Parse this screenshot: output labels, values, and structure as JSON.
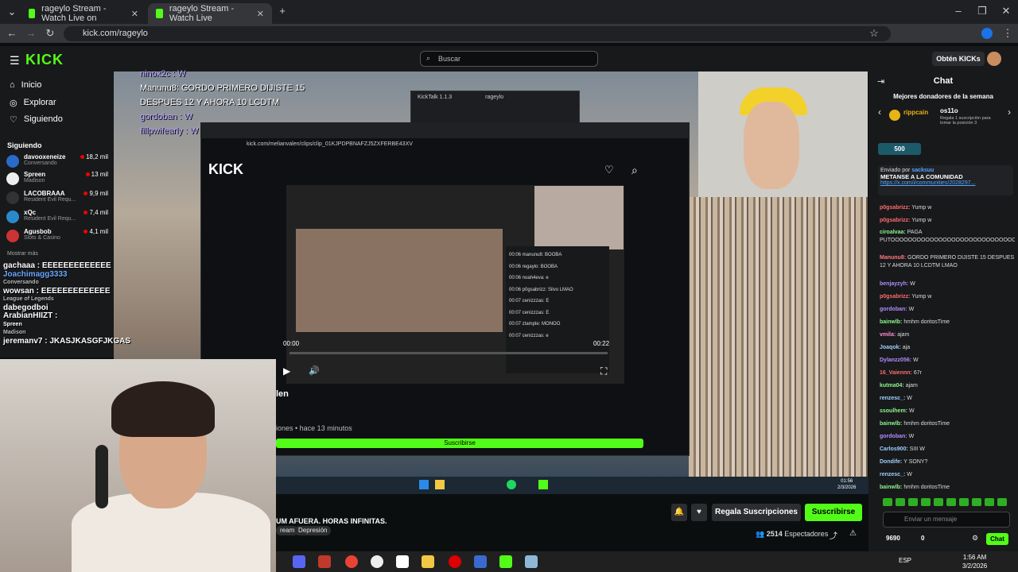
{
  "browser": {
    "tabs": [
      {
        "label": "rageylo Stream - Watch Live on"
      },
      {
        "label": "rageylo Stream - Watch Live"
      }
    ],
    "url": "kick.com/rageylo"
  },
  "kick": {
    "logo": "KICK",
    "search_placeholder": "Buscar",
    "obtain_kicks": "Obtén KICKs"
  },
  "sidebar": {
    "nav": [
      {
        "label": "Inicio"
      },
      {
        "label": "Explorar"
      },
      {
        "label": "Siguiendo"
      }
    ],
    "following_title": "Siguiendo",
    "following": [
      {
        "name": "davooxeneize",
        "game": "Conversando",
        "viewers": "18,2 mil"
      },
      {
        "name": "Spreen",
        "game": "Madison",
        "viewers": "13 mil"
      },
      {
        "name": "LACOBRAAA",
        "game": "Resident Evil Requ...",
        "viewers": "9,9 mil"
      },
      {
        "name": "xQc",
        "game": "Resident Evil Requ...",
        "viewers": "7,4 mil"
      },
      {
        "name": "Agusbob",
        "game": "Slots & Casino",
        "viewers": "4,1 mil"
      }
    ],
    "show_more": "Mostrar más"
  },
  "overlay": {
    "chat_lines": [
      "ninox2c : W",
      "Manunu8: GORDO PRIMERO DIJISTE 15",
      "DESPUES 12 Y AHORA 10 LCDTM",
      "gordoban : W",
      "fillpwifearly : W"
    ],
    "follow_lines": [
      "gachaaa : EEEEEEEEEEEEE",
      "Joachimagg3333",
      "Conversando",
      "wowsan : EEEEEEEEEEEEE",
      "League of Legends",
      "dabegodboi",
      "ArabianHIIZT :",
      "Spreen",
      "Madison",
      "jeremanv7 : JKASJKASGFJKGAS"
    ]
  },
  "inner": {
    "url": "kick.com/melianvalen/clips/clip_01KJPDPBNAFZJ5ZXFERBE43XV",
    "logo": "KICK",
    "title": "len",
    "meta": "iones • hace 13 minutos",
    "subscribe": "Suscribirse",
    "time_left": "00:00",
    "time_right": "00:22",
    "chat": [
      "00:06 manunu8: BOOBA",
      "00:06 regaylo: BOOBA",
      "00:06 noah4eva: e",
      "00:06 p0gsabrizz: Silvo LMAO",
      "00:07 cenizzzas: E",
      "00:07 cenizzzas: E",
      "00:07 ztample: MONOO",
      "00:07 cenizzzas: e"
    ],
    "kicktalk": "KickTalk 1.1.3",
    "kicktalk_user": "rageylo",
    "taskbar_time": "01:56",
    "taskbar_date": "2/3/2026"
  },
  "stream": {
    "title": "UM AFUERA. HORAS INFINITAS.",
    "tags": [
      "ream",
      "Depresión"
    ],
    "gift_btn": "Regala Suscripciones",
    "sub_btn": "Suscribirse",
    "viewers": "2514",
    "viewers_label": "Espectadores"
  },
  "chat": {
    "title": "Chat",
    "top_donors": "Mejores donadores de la semana",
    "donor1": "rippcain",
    "donor2": "os11o",
    "donor2_note": "Regala 1 suscripción para tomar la posición 3",
    "badge": "500",
    "pinned_by": "Enviado por",
    "pinned_user": "sacksuu",
    "pinned_title": "METANSE A LA COMUNIDAD",
    "pinned_link": "https://x.com/i/communities/2028297...",
    "messages": [
      {
        "user": "p0gsabrizz:",
        "text": "Yump w",
        "color": "#ff6b6b",
        "cls": ""
      },
      {
        "user": "p0gsabrizz:",
        "text": "Yump w",
        "color": "#ff6b6b",
        "cls": ""
      },
      {
        "user": "ciroalvaa:",
        "text": "PAGA PUTOOOOOOOOOOOOOOOOOOOOOOOOOOOOOOOOOOO",
        "color": "#8cf58c",
        "cls": "two"
      },
      {
        "user": "Manunu8:",
        "text": "GORDO PRIMERO DIJISTE 15 DESPUES 12 Y AHORA 10 LCDTM LMAO",
        "color": "#ff7a7a",
        "cls": "two"
      },
      {
        "user": "benjayzyh:",
        "text": "W",
        "color": "#b28cff",
        "cls": ""
      },
      {
        "user": "p0gsabrizz:",
        "text": "Yump w",
        "color": "#ff6b6b",
        "cls": ""
      },
      {
        "user": "gordoban:",
        "text": "W",
        "color": "#b28cff",
        "cls": ""
      },
      {
        "user": "bainwlb:",
        "text": "hmhm doritosTime",
        "color": "#8cf58c",
        "cls": ""
      },
      {
        "user": "vmila:",
        "text": "ajam",
        "color": "#ff8fd8",
        "cls": ""
      },
      {
        "user": "Joaqok:",
        "text": "aja",
        "color": "#9fd0ff",
        "cls": ""
      },
      {
        "user": "Dylanzz056:",
        "text": "W",
        "color": "#b28cff",
        "cls": ""
      },
      {
        "user": "16_Vaiennn:",
        "text": "67r",
        "color": "#ff6b6b",
        "cls": ""
      },
      {
        "user": "kutma04:",
        "text": "ajam",
        "color": "#8cf58c",
        "cls": ""
      },
      {
        "user": "renzesc_:",
        "text": "W",
        "color": "#9fd0ff",
        "cls": ""
      },
      {
        "user": "ssoulhem:",
        "text": "W",
        "color": "#8cf58c",
        "cls": ""
      },
      {
        "user": "bainwlb:",
        "text": "hmhm doritosTime",
        "color": "#8cf58c",
        "cls": ""
      },
      {
        "user": "gordoban:",
        "text": "W",
        "color": "#b28cff",
        "cls": ""
      },
      {
        "user": "Carlos900:",
        "text": "SIII W",
        "color": "#9fd0ff",
        "cls": ""
      },
      {
        "user": "Dondife:",
        "text": "Y SONY?",
        "color": "#9fd0ff",
        "cls": ""
      },
      {
        "user": "renzesc_:",
        "text": "W",
        "color": "#9fd0ff",
        "cls": ""
      },
      {
        "user": "bainwlb:",
        "text": "hmhm doritosTime",
        "color": "#8cf58c",
        "cls": ""
      }
    ],
    "input_placeholder": "Enviar un mensaje",
    "chat_btn": "Chat",
    "points": "9690",
    "points2": "0"
  },
  "taskbar": {
    "lang": "ESP",
    "time": "1:56 AM",
    "date": "3/2/2026"
  },
  "colors": {
    "accent": "#53fc18"
  }
}
